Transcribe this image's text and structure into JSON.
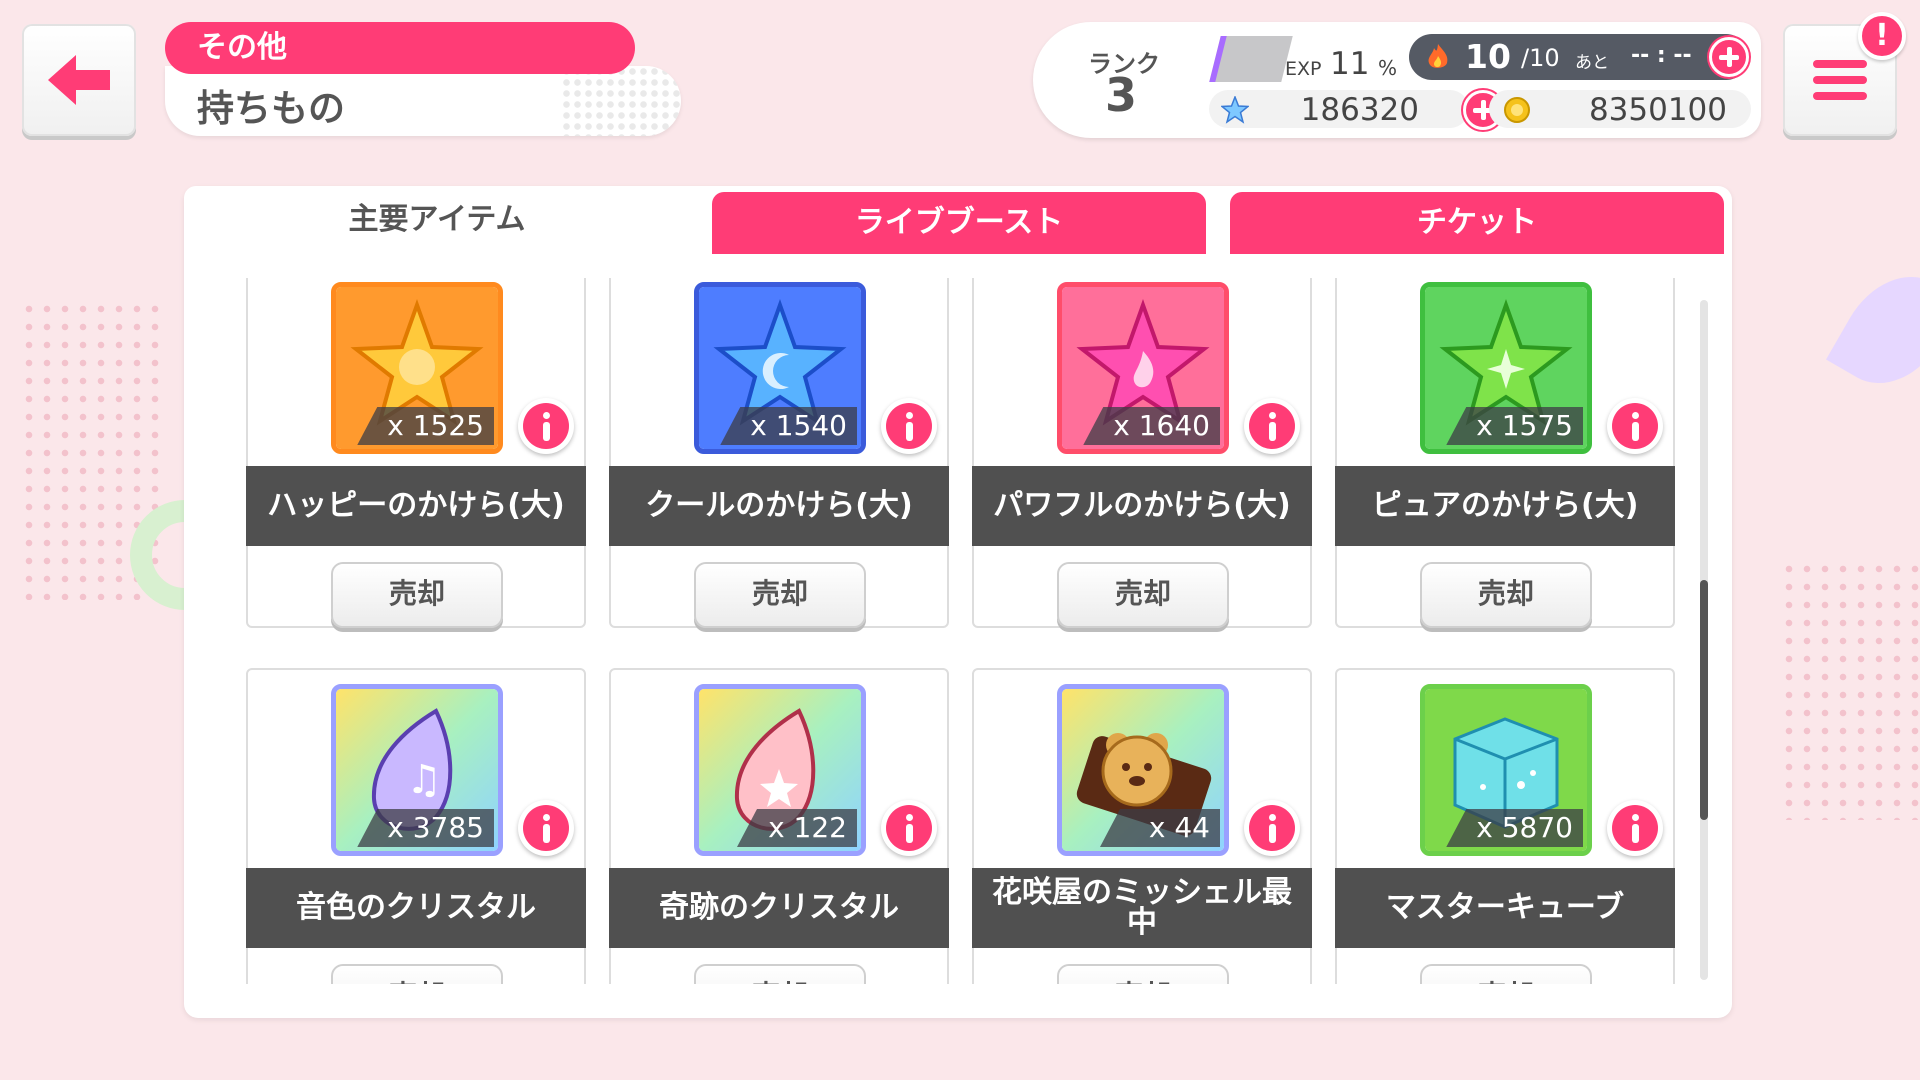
{
  "header": {
    "category": "その他",
    "title": "持ちもの"
  },
  "status": {
    "rank_label": "ランク",
    "rank_value": "3",
    "exp_label": "EXP",
    "exp_value": "11",
    "exp_unit": "%",
    "stamina_current": "10",
    "stamina_max": "/10",
    "stamina_suffix": "あと",
    "stamina_timer": "-- : --",
    "star_gems": "186320",
    "coins": "8350100"
  },
  "tabs": [
    {
      "label": "主要アイテム",
      "active": true
    },
    {
      "label": "ライブブースト",
      "active": false
    },
    {
      "label": "チケット",
      "active": false
    }
  ],
  "items": [
    {
      "name": "ハッピーのかけら(大)",
      "qty": "x 1525",
      "icon": "happy-star-shard-icon",
      "frame": "#ff8a1e",
      "sell": "売却"
    },
    {
      "name": "クールのかけら(大)",
      "qty": "x 1540",
      "icon": "cool-star-shard-icon",
      "frame": "#3b5bdb",
      "sell": "売却"
    },
    {
      "name": "パワフルのかけら(大)",
      "qty": "x 1640",
      "icon": "powerful-star-shard-icon",
      "frame": "#ff4d6a",
      "sell": "売却"
    },
    {
      "name": "ピュアのかけら(大)",
      "qty": "x 1575",
      "icon": "pure-star-shard-icon",
      "frame": "#3fbf3f",
      "sell": "売却"
    },
    {
      "name": "音色のクリスタル",
      "qty": "x 3785",
      "icon": "tone-crystal-icon",
      "frame": "#9aa0ff",
      "sell": "売却"
    },
    {
      "name": "奇跡のクリスタル",
      "qty": "x 122",
      "icon": "miracle-crystal-icon",
      "frame": "#9aa0ff",
      "sell": "売却"
    },
    {
      "name": "花咲屋のミッシェル最中",
      "qty": "x 44",
      "icon": "michelle-monaka-icon",
      "frame": "#9aa0ff",
      "sell": "売却"
    },
    {
      "name": "マスターキューブ",
      "qty": "x 5870",
      "icon": "master-cube-icon",
      "frame": "#6cd04b",
      "sell": "売却"
    }
  ]
}
